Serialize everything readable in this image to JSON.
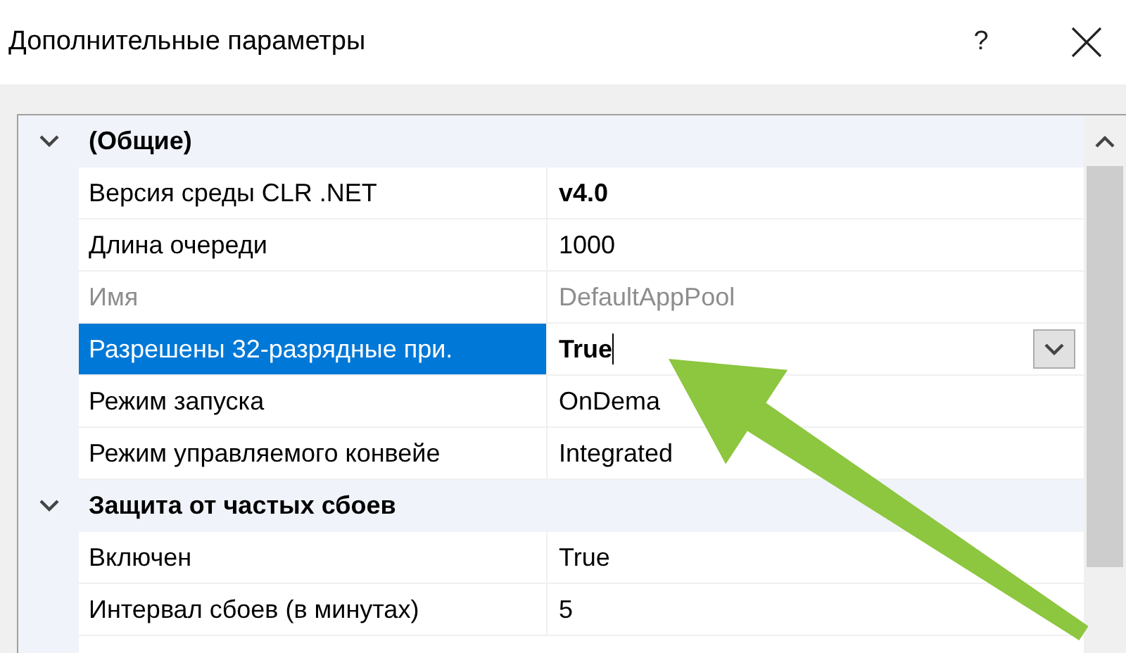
{
  "window": {
    "title": "Дополнительные параметры",
    "help_button": "?"
  },
  "categories": [
    {
      "name": "(Общие)",
      "expanded": true,
      "properties": [
        {
          "name": "Версия среды CLR .NET",
          "value": "v4.0",
          "modified": true,
          "disabled": false,
          "selected": false,
          "kind": "text"
        },
        {
          "name": "Длина очереди",
          "value": "1000",
          "modified": false,
          "disabled": false,
          "selected": false,
          "kind": "text"
        },
        {
          "name": "Имя",
          "value": "DefaultAppPool",
          "modified": false,
          "disabled": true,
          "selected": false,
          "kind": "text"
        },
        {
          "name": "Разрешены 32-разрядные при.",
          "value": "True",
          "modified": true,
          "disabled": false,
          "selected": true,
          "kind": "dropdown"
        },
        {
          "name": "Режим запуска",
          "value": "OnDema",
          "modified": false,
          "disabled": false,
          "selected": false,
          "kind": "text"
        },
        {
          "name": "Режим управляемого конвейе",
          "value": "Integrated",
          "modified": false,
          "disabled": false,
          "selected": false,
          "kind": "text"
        }
      ]
    },
    {
      "name": "Защита от частых сбоев",
      "expanded": true,
      "properties": [
        {
          "name": "Включен",
          "value": "True",
          "modified": false,
          "disabled": false,
          "selected": false,
          "kind": "text"
        },
        {
          "name": "Интервал сбоев (в минутах)",
          "value": "5",
          "modified": false,
          "disabled": false,
          "selected": false,
          "kind": "text"
        }
      ]
    }
  ]
}
